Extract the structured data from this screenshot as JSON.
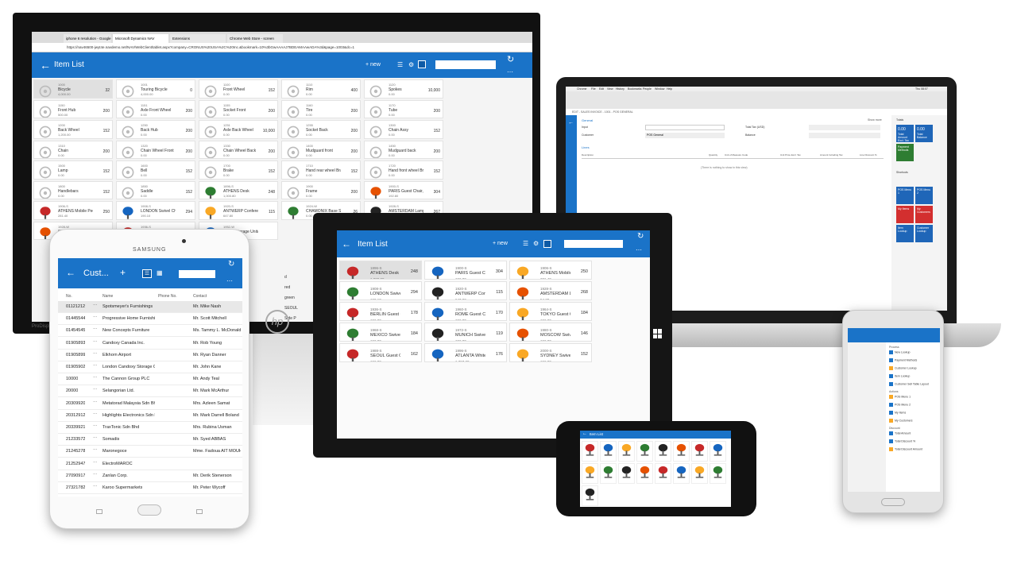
{
  "monitor": {
    "browser_tabs": [
      "iphone 6 resolution - Google",
      "Microsoft Dynamics NAV",
      "Extensions",
      "Chrome Web Store - screen"
    ],
    "url": "https://nav46500-jwyt4e.navdemo.net/NAV/WebClient/tablet.aspx?company=CRONUS%20USA%2C%20Inc.&bookmark=10%3bGwAAAAJ7BDEAMAAwADA%3d&page=1003&dc=1",
    "page_title": "Item List",
    "new_label": "+ new",
    "brand": "ProDisplay",
    "items": [
      {
        "no": "1000",
        "desc": "Bicycle",
        "price": "4,000.00",
        "qty": "32"
      },
      {
        "no": "1001",
        "desc": "Touring Bicycle",
        "price": "4,000.00",
        "qty": "0"
      },
      {
        "no": "1100",
        "desc": "Front Wheel",
        "price": "0.00",
        "qty": "152"
      },
      {
        "no": "1110",
        "desc": "Rim",
        "price": "0.00",
        "qty": "400"
      },
      {
        "no": "1120",
        "desc": "Spokes",
        "price": "0.00",
        "qty": "10,000"
      },
      {
        "no": "1150",
        "desc": "Front Hub",
        "price": "500.00",
        "qty": "200"
      },
      {
        "no": "1151",
        "desc": "Axle Front Wheel",
        "price": "0.00",
        "qty": "200"
      },
      {
        "no": "1155",
        "desc": "Socket Front",
        "price": "0.00",
        "qty": "200"
      },
      {
        "no": "1160",
        "desc": "Tire",
        "price": "0.00",
        "qty": "200"
      },
      {
        "no": "1170",
        "desc": "Tube",
        "price": "0.00",
        "qty": "200"
      },
      {
        "no": "1200",
        "desc": "Back Wheel",
        "price": "1,200.00",
        "qty": "152"
      },
      {
        "no": "1250",
        "desc": "Back Hub",
        "price": "0.00",
        "qty": "200"
      },
      {
        "no": "1251",
        "desc": "Axle Back Wheel",
        "price": "0.00",
        "qty": "10,000"
      },
      {
        "no": "1255",
        "desc": "Socket Back",
        "price": "0.00",
        "qty": "200"
      },
      {
        "no": "1300",
        "desc": "Chain Assy",
        "price": "0.00",
        "qty": "152"
      },
      {
        "no": "1310",
        "desc": "Chain",
        "price": "0.00",
        "qty": "200"
      },
      {
        "no": "1320",
        "desc": "Chain Wheel Front",
        "price": "0.00",
        "qty": "200"
      },
      {
        "no": "1330",
        "desc": "Chain Wheel Back",
        "price": "0.00",
        "qty": "200"
      },
      {
        "no": "1400",
        "desc": "Mudguard front",
        "price": "0.00",
        "qty": "200"
      },
      {
        "no": "1450",
        "desc": "Mudguard back",
        "price": "0.00",
        "qty": "200"
      },
      {
        "no": "1500",
        "desc": "Lamp",
        "price": "0.00",
        "qty": "152"
      },
      {
        "no": "1600",
        "desc": "Bell",
        "price": "0.00",
        "qty": "152"
      },
      {
        "no": "1700",
        "desc": "Brake",
        "price": "0.00",
        "qty": "152"
      },
      {
        "no": "1710",
        "desc": "Hand rear wheel Brake",
        "price": "0.00",
        "qty": "152"
      },
      {
        "no": "1720",
        "desc": "Hand front wheel Brake",
        "price": "0.00",
        "qty": "152"
      },
      {
        "no": "1800",
        "desc": "Handlebars",
        "price": "0.00",
        "qty": "152"
      },
      {
        "no": "1850",
        "desc": "Saddle",
        "price": "0.00",
        "qty": "152"
      },
      {
        "no": "1896-S",
        "desc": "ATHENS Desk",
        "price": "1,000.80",
        "qty": "248"
      },
      {
        "no": "1900",
        "desc": "Frame",
        "price": "0.00",
        "qty": "200"
      },
      {
        "no": "1900-S",
        "desc": "PARIS Guest Chair, black",
        "price": "192.80",
        "qty": "304"
      },
      {
        "no": "1906-S",
        "desc": "ATHENS Mobile Pedestal",
        "price": "281.40",
        "qty": "250"
      },
      {
        "no": "1908-S",
        "desc": "LONDON Swivel Chair, blue",
        "price": "190.10",
        "qty": "294"
      },
      {
        "no": "1920-S",
        "desc": "ANTWERP Conference Table",
        "price": "647.80",
        "qty": "115"
      },
      {
        "no": "1924-W",
        "desc": "CHAMONIX Base Storage Unit",
        "price": "0.00",
        "qty": "26"
      },
      {
        "no": "1928-S",
        "desc": "AMSTERDAM Lamp",
        "price": "54.30",
        "qty": "267"
      },
      {
        "no": "1928-W",
        "desc": "ST.MORITZ Storage Unit/Dra...",
        "price": "0.00",
        "qty": "67"
      },
      {
        "no": "1936-S",
        "desc": "BERLIN Guest Chair, yellow",
        "price": "192.80",
        "qty": "178"
      },
      {
        "no": "1952-W",
        "desc": "OSLO Storage Unit/Shelf",
        "price": "0.00",
        "qty": ""
      }
    ],
    "partial_items": [
      "d",
      "red",
      "green",
      "SEOUL",
      "Side P"
    ]
  },
  "laptop": {
    "menu": [
      "Chrome",
      "File",
      "Edit",
      "View",
      "History",
      "Bookmarks",
      "People",
      "Window",
      "Help"
    ],
    "clock": "Thu 08:07",
    "page_label": "EDIT - SALES INVOICE - 1001 - POS GENERAL",
    "section_general": "General",
    "show_more": "Show more",
    "fields": {
      "input": "Input",
      "customer": "Customer",
      "customer_val": "POS General",
      "total_tax": "Total Tax (USD)",
      "balance": "Balance"
    },
    "lines": "Lines",
    "columns": [
      "Description",
      "Quantity",
      "Unit of Measure Code",
      "Unit Price Excl. Tax",
      "Amount Including Tax",
      "Line Discount %"
    ],
    "empty": "(There is nothing to show in this view)",
    "totals_label": "Totals",
    "shortcuts_label": "Shortcuts",
    "tiles": [
      {
        "v": "0.00",
        "l": "Total Amount Excl. Tax"
      },
      {
        "v": "0.00",
        "l": "Total Balance"
      },
      {
        "v": "",
        "l": "Payment Methods"
      },
      {
        "v": "",
        "l": "POS Menu 1"
      },
      {
        "v": "",
        "l": "POS Menu 2"
      },
      {
        "v": "",
        "l": "My Items"
      },
      {
        "v": "",
        "l": "My Customers"
      },
      {
        "v": "",
        "l": "Item Lookup"
      },
      {
        "v": "",
        "l": "Customer Lookup"
      }
    ]
  },
  "tablet_left": {
    "brand": "SAMSUNG",
    "title": "Cust...",
    "columns": [
      "No.",
      "Name",
      "Phone No.",
      "Contact"
    ],
    "rows": [
      {
        "no": "01121212",
        "name": "Spotsmeyer's Furnishings",
        "contact": "Mr. Mike Nash"
      },
      {
        "no": "01445544",
        "name": "Progressive Home Furnishin...",
        "contact": "Mr. Scott Mitchell"
      },
      {
        "no": "01454545",
        "name": "New Concepts Furniture",
        "contact": "Ms. Tammy L. McDonald"
      },
      {
        "no": "01905893",
        "name": "Candoxy Canada Inc.",
        "contact": "Mr. Rob Young"
      },
      {
        "no": "01905899",
        "name": "Elkhorn Airport",
        "contact": "Mr. Ryan Danner"
      },
      {
        "no": "01905902",
        "name": "London Candoxy Storage C...",
        "contact": "Mr. John Kane"
      },
      {
        "no": "10000",
        "name": "The Cannon Group PLC",
        "contact": "Mr. Andy Teal"
      },
      {
        "no": "20000",
        "name": "Selangorian Ltd.",
        "contact": "Mr. Mark McArthur"
      },
      {
        "no": "20309920",
        "name": "Metatorad Malaysia Sdn Bhd",
        "contact": "Mrs. Azleen Samat"
      },
      {
        "no": "20312912",
        "name": "Highlights Electronics Sdn B...",
        "contact": "Mr. Mark Darrell Boland"
      },
      {
        "no": "20339921",
        "name": "TraxTonic Sdn Bhd",
        "contact": "Mrs. Rubina Usman"
      },
      {
        "no": "21233572",
        "name": "Somadis",
        "contact": "Mr. Syed ABBAS"
      },
      {
        "no": "21245278",
        "name": "Maronegoce",
        "contact": "Mme. Fadoua AIT MOUH"
      },
      {
        "no": "21252947",
        "name": "ElectroMAROC",
        "contact": ""
      },
      {
        "no": "27090917",
        "name": "Zanlan Corp.",
        "contact": "Mr. Derik Stenerson"
      },
      {
        "no": "27321782",
        "name": "Karoo Supermarkets",
        "contact": "Mr. Peter Wycoff"
      }
    ]
  },
  "tablet_center": {
    "title": "Item List",
    "new_label": "+ new",
    "items": [
      {
        "no": "1896-S",
        "desc": "ATHENS Desk",
        "price": "1,000.80",
        "qty": "248"
      },
      {
        "no": "1900-S",
        "desc": "PARIS Guest Chair, black",
        "price": "192.80",
        "qty": "304"
      },
      {
        "no": "1906-S",
        "desc": "ATHENS Mobile Pedestal",
        "price": "281.40",
        "qty": "250"
      },
      {
        "no": "1908-S",
        "desc": "LONDON Swivel Chair, blue",
        "price": "190.10",
        "qty": "294"
      },
      {
        "no": "1920-S",
        "desc": "ANTWERP Conference Table",
        "price": "647.80",
        "qty": "115"
      },
      {
        "no": "1928-S",
        "desc": "AMSTERDAM Lamp",
        "price": "54.30",
        "qty": "268"
      },
      {
        "no": "1936-S",
        "desc": "BERLIN Guest Chair, yellow",
        "price": "192.80",
        "qty": "178"
      },
      {
        "no": "1960-S",
        "desc": "ROME Guest Chair, green",
        "price": "192.80",
        "qty": "170"
      },
      {
        "no": "1964-S",
        "desc": "TOKYO Guest Chair, blue",
        "price": "192.80",
        "qty": "184"
      },
      {
        "no": "1968-S",
        "desc": "MEXICO Swivel Chair, black",
        "price": "192.80",
        "qty": "184"
      },
      {
        "no": "1972-S",
        "desc": "MUNICH Swivel Chair, yellow",
        "price": "192.80",
        "qty": "119"
      },
      {
        "no": "1980-S",
        "desc": "MOSCOW Swivel Chair, red",
        "price": "192.80",
        "qty": "146"
      },
      {
        "no": "1988-S",
        "desc": "SEOUL Guest Chair, red",
        "price": "192.80",
        "qty": "162"
      },
      {
        "no": "1996-S",
        "desc": "ATLANTA Whiteboard, base",
        "price": "1,397.30",
        "qty": "176"
      },
      {
        "no": "2000-S",
        "desc": "SYDNEY Swivel Chair, green",
        "price": "192.80",
        "qty": "152"
      }
    ]
  },
  "phone_landscape": {
    "title": "Item List"
  },
  "phone_right": {
    "sections": [
      "Process",
      "New",
      "Actions",
      "Discount"
    ],
    "actions": [
      "New Lookup",
      "Payment Methods",
      "Customer Lookup",
      "Item Lookup",
      "Customer Sell Table Layout",
      "POS Menu 1",
      "POS Menu 2",
      "My Items",
      "My Customers",
      "Total Amount",
      "Total Discount %",
      "Total Discount Amount"
    ]
  },
  "colors": {
    "accent": "#1a73c8",
    "laptop_tile": "#1f66b8",
    "laptop_green": "#2e7d32",
    "laptop_red": "#d32f2f"
  }
}
